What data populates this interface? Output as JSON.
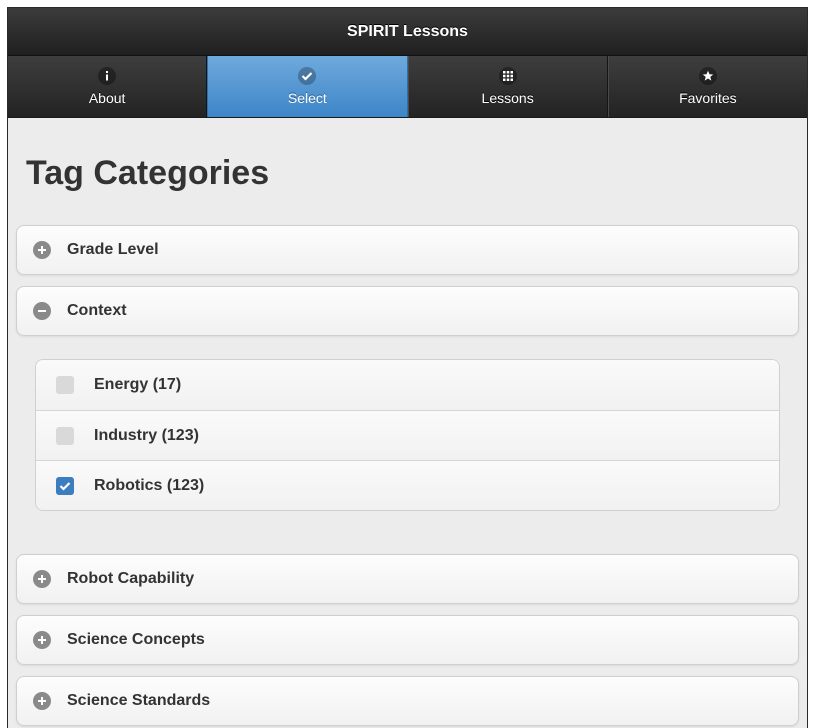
{
  "header": {
    "title": "SPIRIT Lessons"
  },
  "nav": {
    "tabs": [
      {
        "label": "About",
        "icon": "info-icon"
      },
      {
        "label": "Select",
        "icon": "check-icon",
        "active": true
      },
      {
        "label": "Lessons",
        "icon": "grid-icon"
      },
      {
        "label": "Favorites",
        "icon": "star-icon"
      }
    ]
  },
  "page": {
    "title": "Tag Categories"
  },
  "categories": [
    {
      "label": "Grade Level",
      "expanded": false
    },
    {
      "label": "Context",
      "expanded": true,
      "options": [
        {
          "label": "Energy (17)",
          "checked": false
        },
        {
          "label": "Industry (123)",
          "checked": false
        },
        {
          "label": "Robotics (123)",
          "checked": true
        }
      ]
    },
    {
      "label": "Robot Capability",
      "expanded": false
    },
    {
      "label": "Science Concepts",
      "expanded": false
    },
    {
      "label": "Science Standards",
      "expanded": false
    }
  ],
  "colors": {
    "active_tab": "#4a90d2",
    "header_bg": "#2a2a2a",
    "checkbox_checked": "#3b7dbf"
  }
}
